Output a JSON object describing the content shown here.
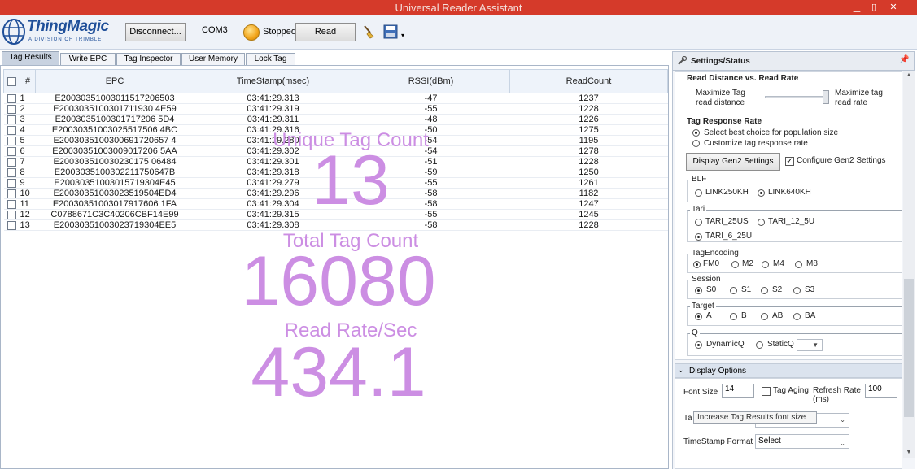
{
  "window": {
    "title": "Universal Reader Assistant",
    "minimize": "▁",
    "maximize": "▯",
    "close": "✕"
  },
  "logo": {
    "name": "ThingMagic",
    "subtitle": "A DIVISION OF TRIMBLE"
  },
  "toolbar": {
    "disconnect_label": "Disconnect...",
    "port": "COM3",
    "status": "Stopped",
    "read_label": "Read"
  },
  "tabs": [
    "Tag Results",
    "Write EPC",
    "Tag Inspector",
    "User Memory",
    "Lock Tag"
  ],
  "table": {
    "headers": [
      "#",
      "EPC",
      "TimeStamp(msec)",
      "RSSI(dBm)",
      "ReadCount"
    ],
    "rows": [
      [
        "1",
        "E20030351003011517206503",
        "03:41:29.313",
        "-47",
        "1237"
      ],
      [
        "2",
        "E2003035100301711930 4E59",
        "03:41:29.319",
        "-55",
        "1228"
      ],
      [
        "3",
        "E2003035100301717206 5D4",
        "03:41:29.311",
        "-48",
        "1226"
      ],
      [
        "4",
        "E20030351003025517506 4BC",
        "03:41:29.316",
        "-50",
        "1275"
      ],
      [
        "5",
        "E2003035100300691720657 4",
        "03:41:29.280",
        "-54",
        "1195"
      ],
      [
        "6",
        "E20030351003009017206 5AA",
        "03:41:29.302",
        "-54",
        "1278"
      ],
      [
        "7",
        "E200303510030230175 06484",
        "03:41:29.301",
        "-51",
        "1228"
      ],
      [
        "8",
        "E2003035100302211750647B",
        "03:41:29.318",
        "-59",
        "1250"
      ],
      [
        "9",
        "E20030351003015719304E45",
        "03:41:29.279",
        "-55",
        "1261"
      ],
      [
        "10",
        "E20030351003023519504ED4",
        "03:41:29.296",
        "-58",
        "1182"
      ],
      [
        "11",
        "E20030351003017917606 1FA",
        "03:41:29.304",
        "-58",
        "1247"
      ],
      [
        "12",
        "C0788671C3C40206CBF14E99",
        "03:41:29.315",
        "-55",
        "1245"
      ],
      [
        "13",
        "E20030351003023719304EE5",
        "03:41:29.308",
        "-58",
        "1228"
      ]
    ]
  },
  "overlay": {
    "unique_label": "Unique Tag Count",
    "unique_value": "13",
    "total_label": "Total Tag Count",
    "total_value": "16080",
    "rate_label": "Read Rate/Sec",
    "rate_value": "434.1"
  },
  "settings": {
    "header": "Settings/Status",
    "pin": "📌",
    "read_distance_title": "Read Distance vs. Read Rate",
    "max_distance": [
      "Maximize Tag",
      "read distance"
    ],
    "max_rate": [
      "Maximize tag",
      "read rate"
    ],
    "tag_response_title": "Tag Response Rate",
    "opt_best": "Select best choice for population size",
    "opt_custom": "Customize tag response rate",
    "display_gen2_label": "Display Gen2 Settings",
    "configure_gen2_label": "Configure Gen2 Settings",
    "blf": {
      "caption": "BLF",
      "options": [
        "LINK250KH",
        "LINK640KH"
      ],
      "selected": 1
    },
    "tari": {
      "caption": "Tari",
      "options": [
        "TARI_25US",
        "TARI_12_5U",
        "TARI_6_25U"
      ],
      "selected": 2
    },
    "encoding": {
      "caption": "TagEncoding",
      "options": [
        "FM0",
        "M2",
        "M4",
        "M8"
      ],
      "selected": 0
    },
    "session": {
      "caption": "Session",
      "options": [
        "S0",
        "S1",
        "S2",
        "S3"
      ],
      "selected": 0
    },
    "target": {
      "caption": "Target",
      "options": [
        "A",
        "B",
        "AB",
        "BA"
      ],
      "selected": 0
    },
    "q": {
      "caption": "Q",
      "options": [
        "DynamicQ",
        "StaticQ"
      ],
      "selected": 0
    }
  },
  "display": {
    "header": "Display Options",
    "font_size_label": "Font Size",
    "font_size_value": "14",
    "aging_label": "Tag Aging",
    "refresh_label": "Refresh Rate",
    "refresh_unit": "(ms)",
    "refresh_value": "100",
    "tooltip": "Increase Tag Results font size",
    "selection_label": "Ta Selection",
    "timestamp_label": "TimeStamp Format",
    "timestamp_value": "Select"
  },
  "colors": {
    "title_bar": "#d53a2a",
    "overlay": "#cc8ee3",
    "brand": "#1f4f99"
  }
}
